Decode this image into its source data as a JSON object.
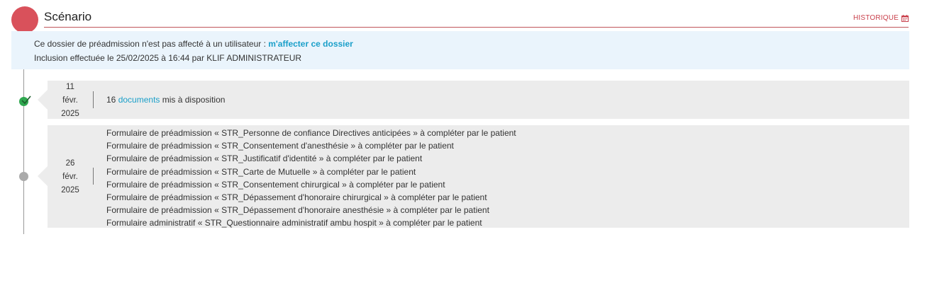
{
  "header": {
    "title": "Scénario",
    "history_label": "HISTORIQUE",
    "history_icon": "calendar-icon",
    "accent_color": "#d9515b"
  },
  "info": {
    "assign_prefix": "Ce dossier de préadmission n'est pas affecté à un utilisateur : ",
    "assign_link": "m'affecter ce dossier",
    "inclusion": "Inclusion effectuée le 25/02/2025 à 16:44 par KLIF ADMINISTRATEUR"
  },
  "timeline": {
    "events": [
      {
        "status": "done",
        "day": "11",
        "month": "févr.",
        "year": "2025",
        "count": "16",
        "link": "documents",
        "suffix": " mis à disposition"
      },
      {
        "status": "pending",
        "day": "26",
        "month": "févr.",
        "year": "2025",
        "lines": [
          "Formulaire de préadmission « STR_Personne de confiance Directives anticipées » à compléter par le patient",
          "Formulaire de préadmission « STR_Consentement d'anesthésie » à compléter par le patient",
          "Formulaire de préadmission « STR_Justificatif d'identité » à compléter par le patient",
          "Formulaire de préadmission « STR_Carte de Mutuelle » à compléter par le patient",
          "Formulaire de préadmission « STR_Consentement chirurgical » à compléter par le patient",
          "Formulaire de préadmission « STR_Dépassement d'honoraire chirurgical » à compléter par le patient",
          "Formulaire de préadmission « STR_Dépassement d'honoraire anesthésie » à compléter par le patient",
          "Formulaire administratif « STR_Questionnaire administratif ambu hospit » à compléter par le patient"
        ]
      }
    ]
  }
}
